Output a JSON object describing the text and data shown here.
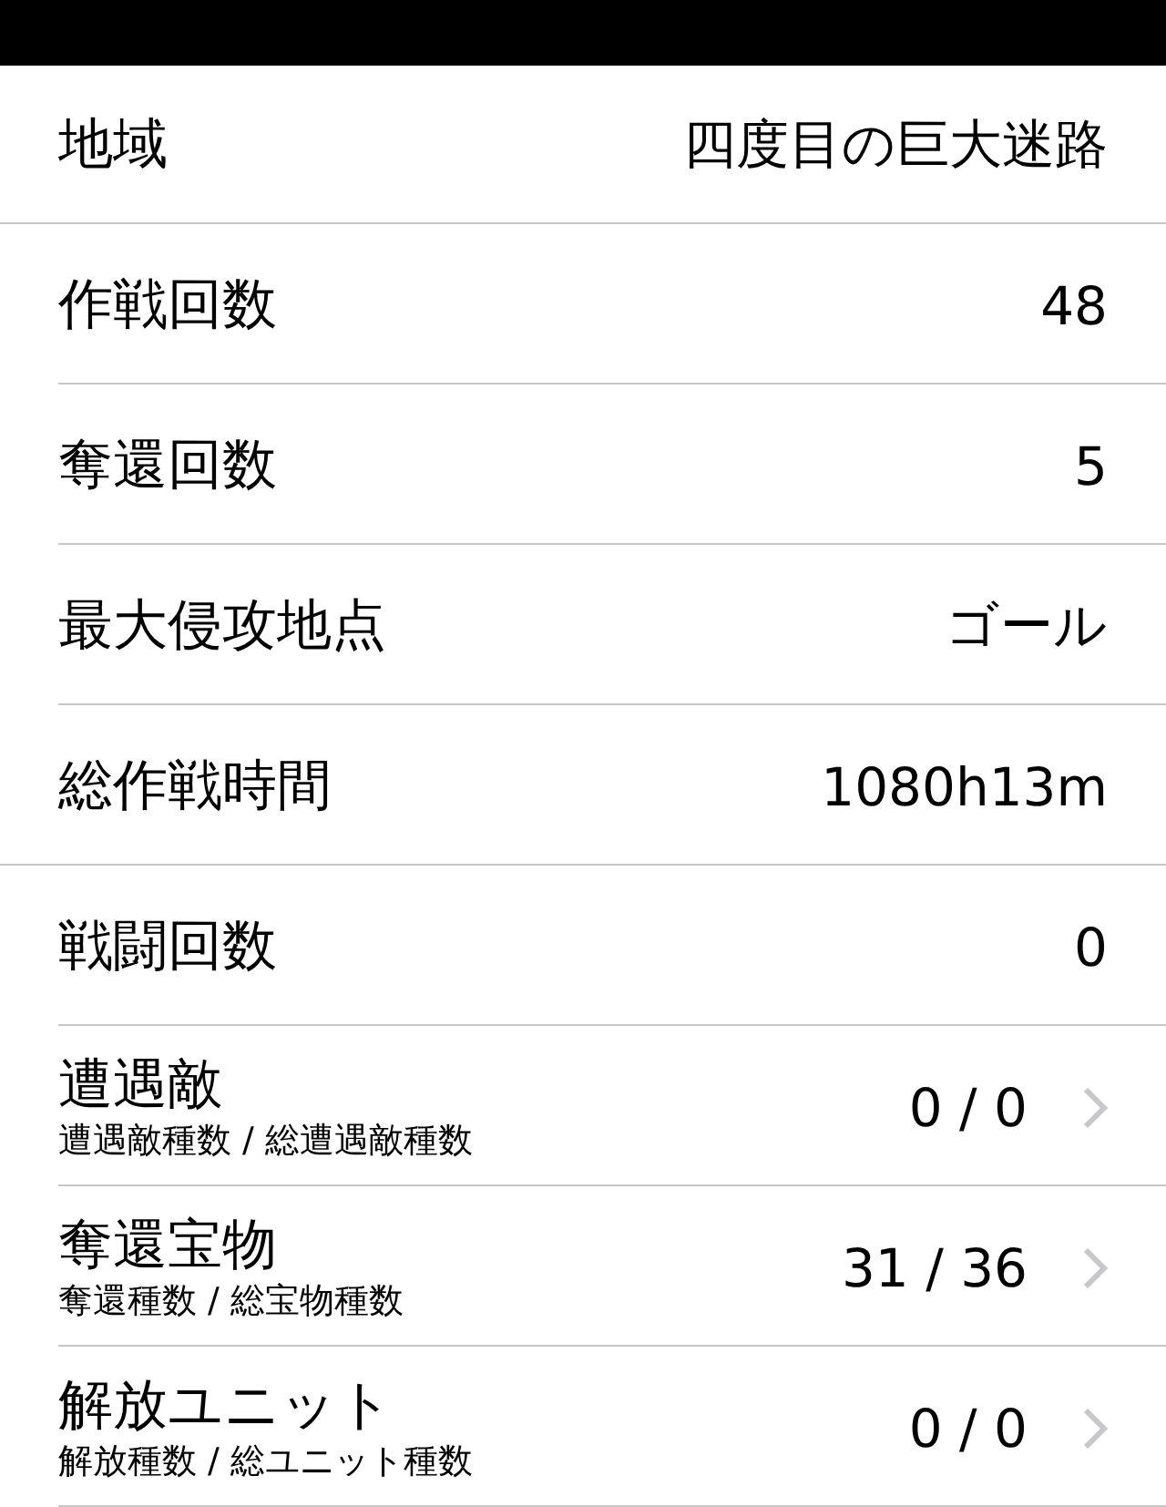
{
  "rows": [
    {
      "kind": "plain",
      "label": "地域",
      "value": "四度目の巨大迷路",
      "section_end": true
    },
    {
      "kind": "plain",
      "label": "作戦回数",
      "value": "48",
      "section_end": false
    },
    {
      "kind": "plain",
      "label": "奪還回数",
      "value": "5",
      "section_end": false
    },
    {
      "kind": "plain",
      "label": "最大侵攻地点",
      "value": "ゴール",
      "section_end": false
    },
    {
      "kind": "plain",
      "label": "総作戦時間",
      "value": "1080h13m",
      "section_end": true
    },
    {
      "kind": "plain",
      "label": "戦闘回数",
      "value": "0",
      "section_end": false
    },
    {
      "kind": "detail",
      "label": "遭遇敵",
      "subtitle": "遭遇敵種数 / 総遭遇敵種数",
      "value": "0 / 0",
      "section_end": false
    },
    {
      "kind": "detail",
      "label": "奪還宝物",
      "subtitle": "奪還種数 / 総宝物種数",
      "value": "31 / 36",
      "section_end": false
    },
    {
      "kind": "detail",
      "label": "解放ユニット",
      "subtitle": "解放種数 / 総ユニット種数",
      "value": "0 / 0",
      "section_end": false
    }
  ]
}
